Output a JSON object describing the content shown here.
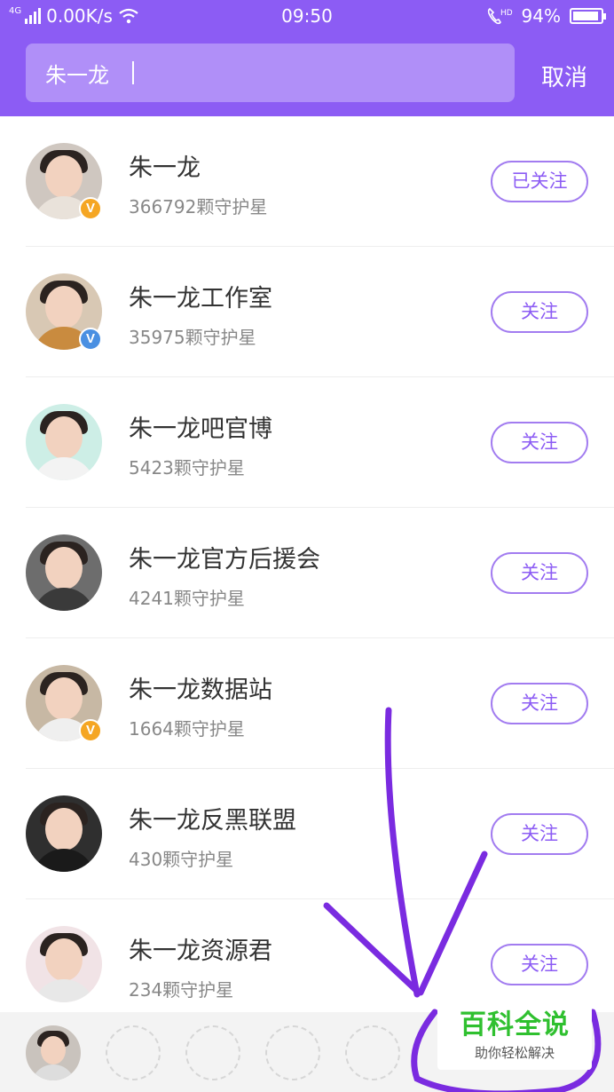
{
  "status_bar": {
    "network_tag": "4G",
    "speed": "0.00K/s",
    "time": "09:50",
    "hd_tag": "HD",
    "battery": "94%",
    "battery_level": 0.94
  },
  "search": {
    "value": "朱一龙",
    "cancel_label": "取消"
  },
  "results": [
    {
      "name": "朱一龙",
      "stars": "366792颗守护星",
      "button": "已关注",
      "badge": "V",
      "badge_color": "gold",
      "avatar_bg": "#cfc7c0",
      "body_color": "#e9e2da"
    },
    {
      "name": "朱一龙工作室",
      "stars": "35975颗守护星",
      "button": "关注",
      "badge": "V",
      "badge_color": "blue",
      "avatar_bg": "#d8c8b4",
      "body_color": "#c98b3f"
    },
    {
      "name": "朱一龙吧官博",
      "stars": "5423颗守护星",
      "button": "关注",
      "badge": "",
      "badge_color": "",
      "avatar_bg": "#cdeee6",
      "body_color": "#f3f3f3"
    },
    {
      "name": "朱一龙官方后援会",
      "stars": "4241颗守护星",
      "button": "关注",
      "badge": "",
      "badge_color": "",
      "avatar_bg": "#6d6d6d",
      "body_color": "#3a3a3a"
    },
    {
      "name": "朱一龙数据站",
      "stars": "1664颗守护星",
      "button": "关注",
      "badge": "V",
      "badge_color": "gold",
      "avatar_bg": "#c7b8a4",
      "body_color": "#efefef"
    },
    {
      "name": "朱一龙反黑联盟",
      "stars": "430颗守护星",
      "button": "关注",
      "badge": "",
      "badge_color": "",
      "avatar_bg": "#2f2f2f",
      "body_color": "#1a1a1a"
    },
    {
      "name": "朱一龙资源君",
      "stars": "234颗守护星",
      "button": "关注",
      "badge": "",
      "badge_color": "",
      "avatar_bg": "#f1e3e6",
      "body_color": "#e8e8e8"
    }
  ],
  "watermark": {
    "title": "百科全说",
    "subtitle": "助你轻松解决"
  },
  "colors": {
    "accent": "#8c5cf4",
    "annotation": "#7a2be0"
  }
}
